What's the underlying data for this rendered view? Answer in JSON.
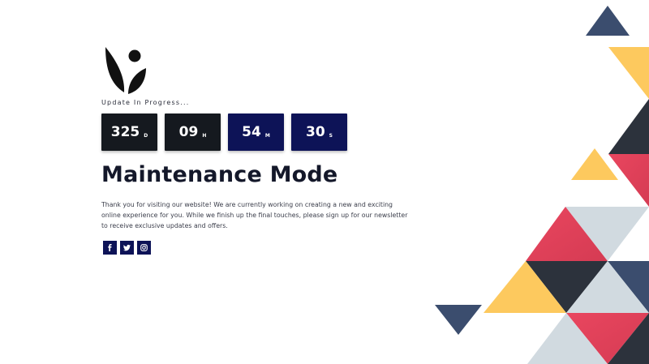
{
  "brand": {
    "logo_icon": "leaf-dot-logo-icon"
  },
  "status_text": "Update In Progress...",
  "countdown": [
    {
      "value": "325",
      "unit": "D",
      "style": "dark"
    },
    {
      "value": "09",
      "unit": "H",
      "style": "dark"
    },
    {
      "value": "54",
      "unit": "M",
      "style": "navy"
    },
    {
      "value": "30",
      "unit": "S",
      "style": "navy"
    }
  ],
  "headline": "Maintenance Mode",
  "description": "Thank you for visiting our website! We are currently working on creating a new and exciting online experience for you. While we finish up the final touches, please sign up for our newsletter to receive exclusive updates and offers.",
  "social": [
    {
      "name": "facebook",
      "icon": "facebook-icon"
    },
    {
      "name": "twitter",
      "icon": "twitter-icon"
    },
    {
      "name": "instagram",
      "icon": "instagram-icon"
    }
  ],
  "colors": {
    "navy": "#0d1357",
    "dark": "#15191f",
    "yellow": "#fdc95e",
    "red": "#e9465f",
    "slate": "#3b4d6e",
    "charcoal": "#2c323c",
    "light_gray": "#d1dae0"
  }
}
